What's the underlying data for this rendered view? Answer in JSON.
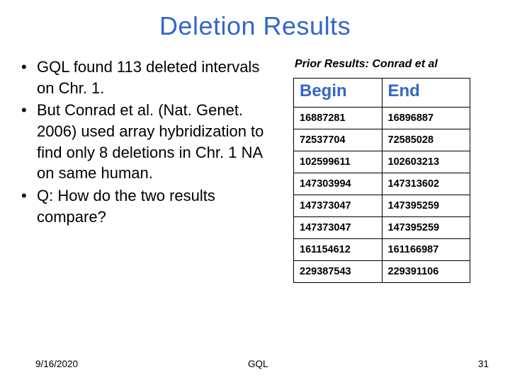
{
  "title": "Deletion Results",
  "bullets": [
    "GQL found 113 deleted intervals  on Chr. 1.",
    "But Conrad et al. (Nat. Genet. 2006) used array hybridization to find only 8 deletions in Chr. 1 NA on same human.",
    "Q: How do the two results compare?"
  ],
  "prior_label": "Prior Results: Conrad et al",
  "table": {
    "headers": [
      "Begin",
      "End"
    ],
    "rows": [
      [
        "16887281",
        "16896887"
      ],
      [
        "72537704",
        "72585028"
      ],
      [
        "102599611",
        "102603213"
      ],
      [
        "147303994",
        "147313602"
      ],
      [
        "147373047",
        "147395259"
      ],
      [
        "147373047",
        "147395259"
      ],
      [
        "161154612",
        "161166987"
      ],
      [
        "229387543",
        "229391106"
      ]
    ]
  },
  "footer": {
    "date": "9/16/2020",
    "mid": "GQL",
    "page": "31"
  }
}
